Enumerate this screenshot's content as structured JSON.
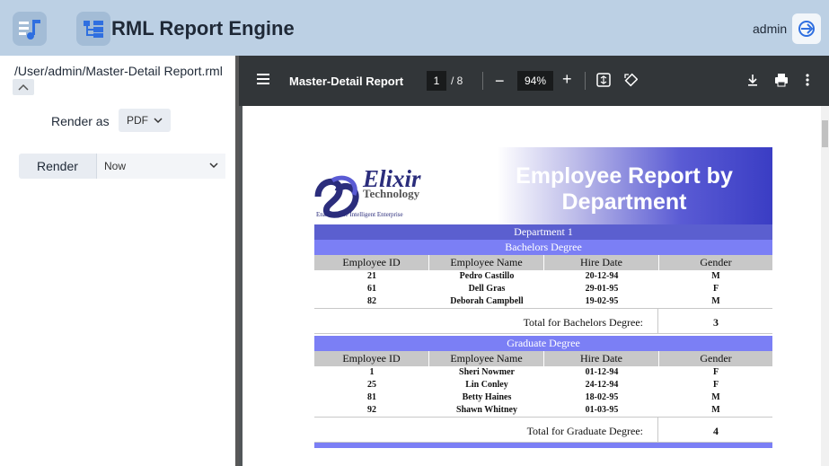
{
  "app": {
    "title": "RML Report Engine",
    "user": "admin"
  },
  "left_panel": {
    "file_path": "/User/admin/Master-Detail Report.rml",
    "render_as_label": "Render as",
    "render_as_value": "PDF",
    "render_button_label": "Render",
    "render_when_value": "Now"
  },
  "pdf_toolbar": {
    "title": "Master-Detail Report",
    "page_current": "1",
    "page_total": "/ 8",
    "zoom": "94%"
  },
  "report": {
    "logo_name": "Elixir",
    "logo_sub": "Technology",
    "logo_tagline": "Enabling the Intelligent Enterprise",
    "title_line1": "Employee Report by",
    "title_line2": "Department",
    "department": "Department 1",
    "columns": [
      "Employee ID",
      "Employee Name",
      "Hire Date",
      "Gender"
    ],
    "groups": [
      {
        "name": "Bachelors Degree",
        "rows": [
          [
            "21",
            "Pedro Castillo",
            "20-12-94",
            "M"
          ],
          [
            "61",
            "Dell Gras",
            "29-01-95",
            "F"
          ],
          [
            "82",
            "Deborah Campbell",
            "19-02-95",
            "M"
          ]
        ],
        "total_label": "Total for Bachelors Degree:",
        "total_value": "3"
      },
      {
        "name": "Graduate Degree",
        "rows": [
          [
            "1",
            "Sheri Nowmer",
            "01-12-94",
            "F"
          ],
          [
            "25",
            "Lin Conley",
            "24-12-94",
            "F"
          ],
          [
            "81",
            "Betty Haines",
            "18-02-95",
            "M"
          ],
          [
            "92",
            "Shawn Whitney",
            "01-03-95",
            "M"
          ]
        ],
        "total_label": "Total for Graduate Degree:",
        "total_value": "4"
      }
    ]
  },
  "colors": {
    "topbar": "#bcd0e4",
    "pdf_toolbar": "#323639",
    "department_band": "#5b5fcf",
    "degree_band": "#7b7ff5"
  }
}
